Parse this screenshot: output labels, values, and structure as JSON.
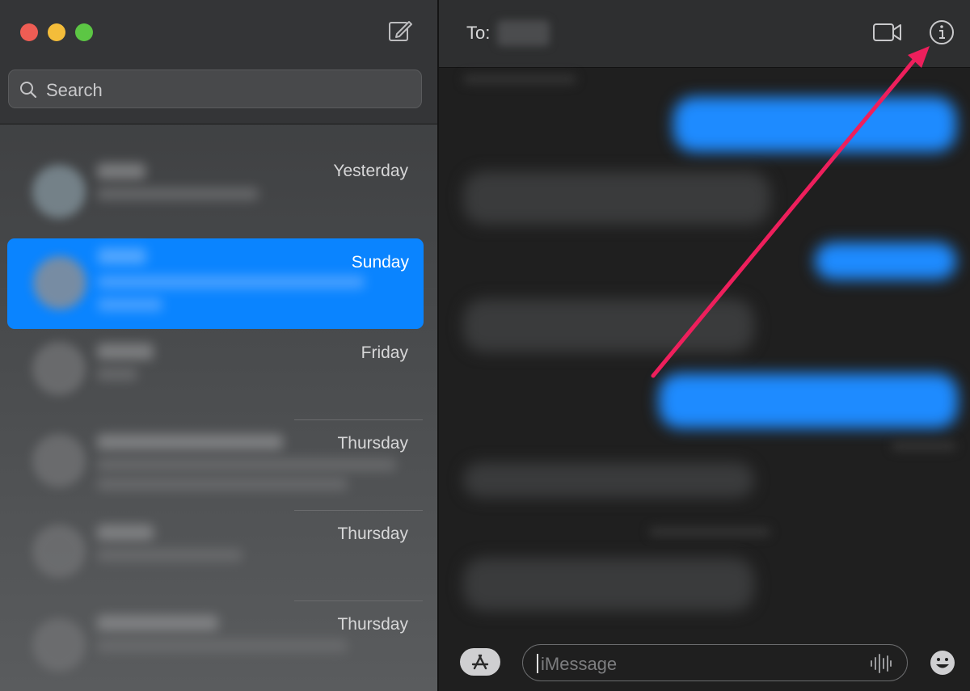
{
  "window": {
    "controls": [
      "close",
      "minimize",
      "zoom"
    ]
  },
  "sidebar": {
    "compose_icon": "compose-icon",
    "search": {
      "placeholder": "Search",
      "icon": "search-icon"
    },
    "conversations": [
      {
        "date": "Yesterday",
        "selected": false
      },
      {
        "date": "Sunday",
        "selected": true
      },
      {
        "date": "Friday",
        "selected": false
      },
      {
        "date": "Thursday",
        "selected": false
      },
      {
        "date": "Thursday",
        "selected": false
      },
      {
        "date": "Thursday",
        "selected": false
      }
    ]
  },
  "header": {
    "to_label": "To:",
    "video_icon": "video-camera-icon",
    "info_icon": "info-icon"
  },
  "composer": {
    "placeholder": "iMessage",
    "apps_icon": "app-store-icon",
    "audio_icon": "audio-waveform-icon",
    "emoji_icon": "emoji-icon"
  },
  "colors": {
    "selected_row": "#0a84ff",
    "sent_bubble": "#1e8bff",
    "annotation_arrow": "#ee1f5c"
  }
}
